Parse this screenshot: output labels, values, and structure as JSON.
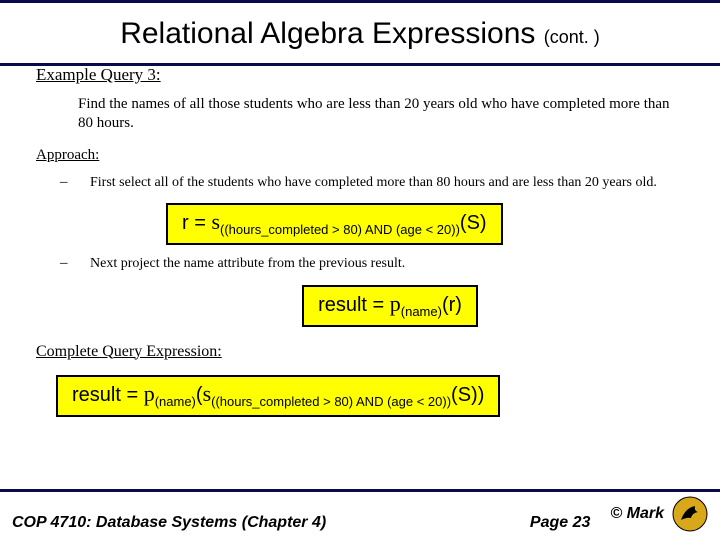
{
  "title": {
    "main": "Relational Algebra Expressions",
    "cont": "(cont. )"
  },
  "example_heading": "Example Query 3:",
  "query_text": "Find the names of all those students who are less than 20 years old who have completed more than 80 hours.",
  "approach_heading": "Approach:",
  "bullets": [
    "First select all of the students who have completed more than 80 hours and are less than 20 years old.",
    "Next project the name attribute from the previous result."
  ],
  "formula1": {
    "lhs": "r = ",
    "sigma": "s",
    "sub": "((hours_completed > 80) AND (age < 20))",
    "rel": "(S)"
  },
  "formula2": {
    "lhs": "result = ",
    "pi": "p",
    "sub": "(name)",
    "rel": "(r)"
  },
  "complete_heading": "Complete Query Expression:",
  "formula3": {
    "lhs": "result = ",
    "pi": "p",
    "sub1": "(name)",
    "open": "(",
    "sigma": "s",
    "sub2": "((hours_completed > 80) AND (age < 20))",
    "rel": "(S))"
  },
  "footer": {
    "left": "COP 4710: Database Systems  (Chapter 4)",
    "mid": "Page 23",
    "right": "© Mark"
  },
  "dash": "–"
}
